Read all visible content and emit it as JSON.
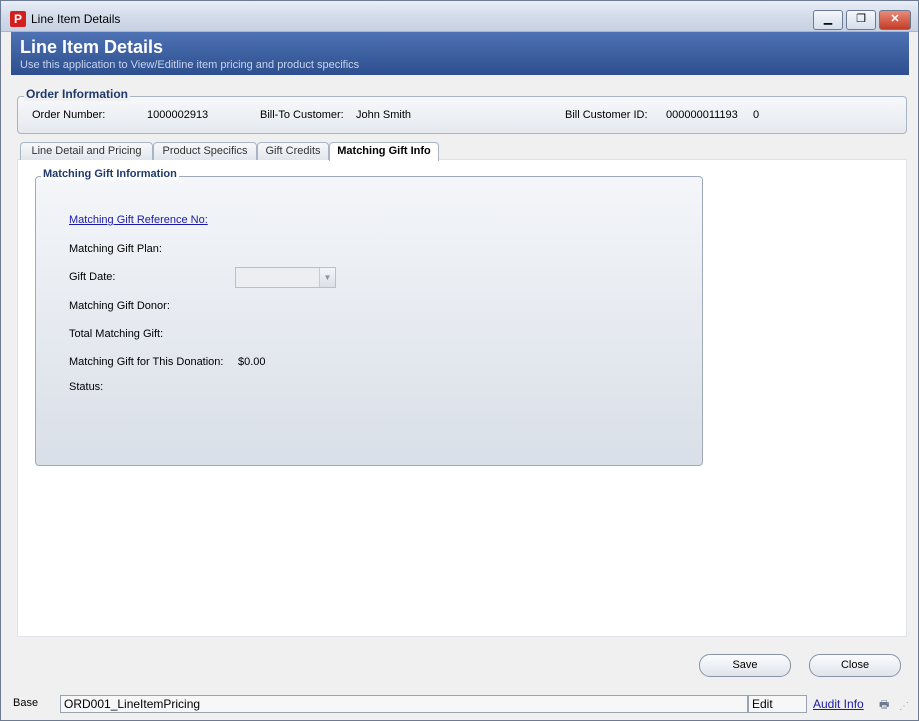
{
  "window": {
    "title": "Line Item Details",
    "app_icon_glyph": "P"
  },
  "header": {
    "title": "Line Item Details",
    "subtitle": "Use this application to View/Editline item pricing and product specifics"
  },
  "order_info": {
    "legend": "Order Information",
    "order_number_label": "Order Number:",
    "order_number_value": "1000002913",
    "bill_to_label": "Bill-To Customer:",
    "bill_to_value": "John Smith",
    "bill_id_label": "Bill Customer ID:",
    "bill_id_value": "000000011193",
    "bill_id_suffix": "0"
  },
  "tabs": [
    {
      "label": "Line Detail and Pricing"
    },
    {
      "label": "Product Specifics"
    },
    {
      "label": "Gift Credits"
    },
    {
      "label": "Matching Gift Info",
      "active": true
    }
  ],
  "matching_gift": {
    "legend": "Matching Gift Information",
    "reference_label": "Matching Gift Reference No:",
    "plan_label": "Matching Gift Plan:",
    "gift_date_label": "Gift Date:",
    "donor_label": "Matching Gift Donor:",
    "total_label": "Total Matching Gift:",
    "this_donation_label": "Matching Gift for This Donation:",
    "this_donation_value": "$0.00",
    "status_label": "Status:"
  },
  "buttons": {
    "save": "Save",
    "close": "Close"
  },
  "statusbar": {
    "mode": "Base",
    "form_name": "ORD001_LineItemPricing",
    "state": "Edit",
    "audit_link": "Audit Info"
  },
  "colors": {
    "header_blue": "#3b5fa3",
    "link": "#1a1aa6",
    "close_red": "#c33c27"
  }
}
